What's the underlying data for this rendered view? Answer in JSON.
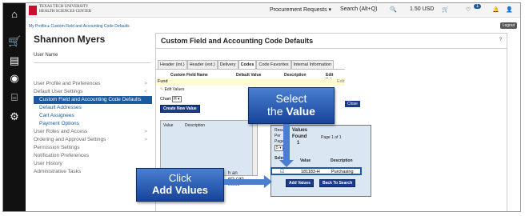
{
  "brand": {
    "line1": "TEXAS TECH UNIVERSITY",
    "line2": "HEALTH SCIENCES CENTER"
  },
  "topbar": {
    "procurement": "Procurement Requests ▾",
    "search": "Search (Alt+Q)",
    "currency": "1.50 USD",
    "badge": "1"
  },
  "breadcrumb": "My Profile ▸ Custom Field and Accounting Code Defaults",
  "logout": "Logout",
  "user": {
    "name": "Shannon Myers",
    "label": "User Name"
  },
  "menu": [
    {
      "label": "User Profile and Preferences",
      "caret": ">"
    },
    {
      "label": "Default User Settings",
      "caret": "<"
    },
    {
      "label": "Custom Field and Accounting Code Defaults",
      "caret": ""
    },
    {
      "label": "Default Addresses",
      "caret": ""
    },
    {
      "label": "Cart Assignees",
      "caret": ""
    },
    {
      "label": "Payment Options",
      "caret": ""
    },
    {
      "label": "User Roles and Access",
      "caret": ">"
    },
    {
      "label": "Ordering and Approval Settings",
      "caret": ">"
    },
    {
      "label": "Permission Settings",
      "caret": ""
    },
    {
      "label": "Notification Preferences",
      "caret": ""
    },
    {
      "label": "User History",
      "caret": ""
    },
    {
      "label": "Administrative Tasks",
      "caret": ""
    }
  ],
  "main": {
    "title": "Custom Field and Accounting Code Defaults",
    "tabs": [
      "Header (int.)",
      "Header (ext.)",
      "Delivery",
      "Codes",
      "Code Favorites",
      "Internal Information"
    ],
    "help": "?",
    "cols": [
      "Custom Field Name",
      "Default Value",
      "Description",
      "Edit Values"
    ],
    "fund": "Fund",
    "edit_link": "Edit",
    "edit_values": "Edit Values",
    "chart_label": "Chart",
    "chart_value": "H ▾",
    "create_btn": "Create New Value",
    "list_value": "Value",
    "list_desc": "Description",
    "close": "Close"
  },
  "popup": {
    "results_per": "Results",
    "per": "Per",
    "page": "Page",
    "per_value": "5 ▾",
    "values_found": "Values",
    "found": "Found",
    "found_count": "1",
    "page_nav": "Page 1 of 1",
    "select": "Select",
    "value": "Value",
    "description": "Description",
    "row_value": "181183-H",
    "row_desc": "Purchasing",
    "add_btn": "Add Values",
    "back_btn": "Back To Search"
  },
  "partial_text": [
    "h an",
    "ers can",
    "these"
  ],
  "callouts": {
    "select_line1": "Select",
    "select_line2a": "the ",
    "select_line2b": "Value",
    "click_line1": "Click",
    "click_line2": "Add Values"
  }
}
